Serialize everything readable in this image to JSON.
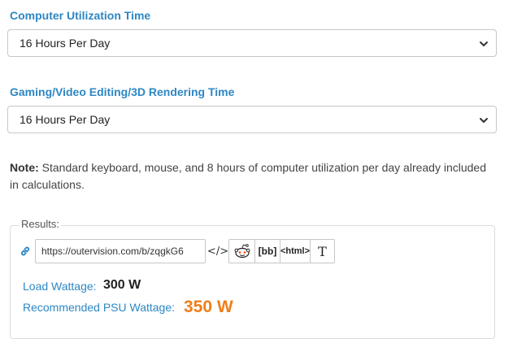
{
  "utilization": {
    "label": "Computer Utilization Time",
    "selected": "16 Hours Per Day"
  },
  "gaming": {
    "label": "Gaming/Video Editing/3D Rendering Time",
    "selected": "16 Hours Per Day"
  },
  "note": {
    "prefix": "Note:",
    "text": " Standard keyboard, mouse, and 8 hours of computer utilization per day already included in calculations."
  },
  "results": {
    "legend": "Results:",
    "share_url": "https://outervision.com/b/zqgkG6",
    "embed_label": "</>",
    "bbcode_label": "[bb]",
    "html_label": "<html>",
    "text_label": "T",
    "load_wattage_label": "Load Wattage:",
    "load_wattage_value": "300 W",
    "psu_wattage_label": "Recommended PSU Wattage:",
    "psu_wattage_value": "350 W"
  },
  "colors": {
    "label_blue": "#2d87c4",
    "psu_orange": "#f07d1a"
  },
  "icons": [
    "chevron-down-icon",
    "link-icon",
    "reddit-icon"
  ]
}
